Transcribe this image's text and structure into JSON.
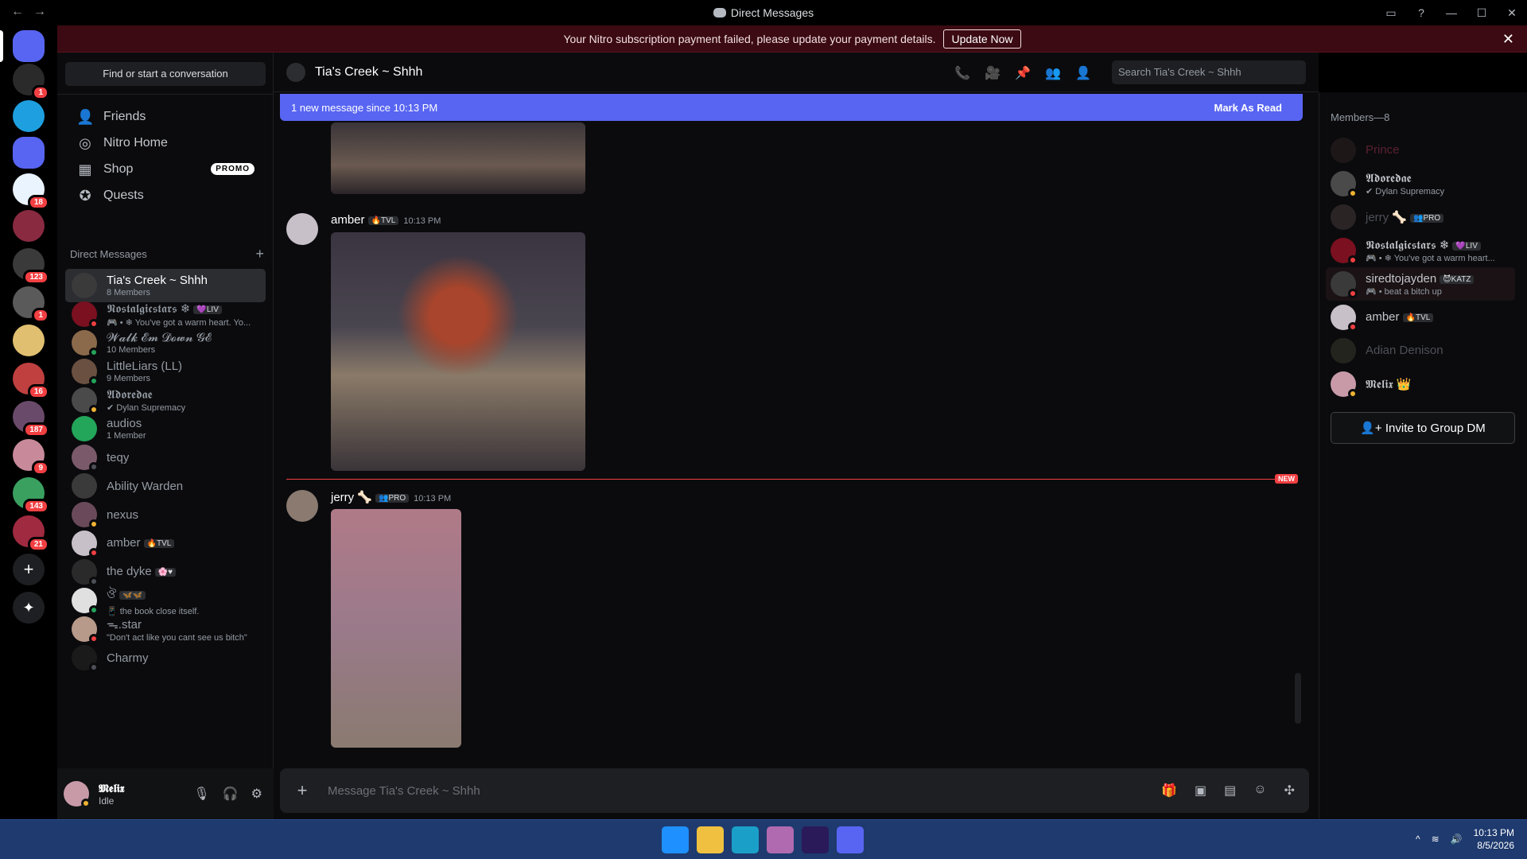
{
  "window": {
    "title": "Direct Messages"
  },
  "banner": {
    "text": "Your Nitro subscription payment failed, please update your payment details.",
    "button": "Update Now"
  },
  "servers": [
    {
      "badge": "1"
    },
    {
      "badge": ""
    },
    {
      "badge": ""
    },
    {
      "badge": "18"
    },
    {
      "badge": ""
    },
    {
      "badge": "123"
    },
    {
      "badge": "1"
    },
    {
      "badge": ""
    },
    {
      "badge": "16"
    },
    {
      "badge": "187"
    },
    {
      "badge": "9"
    },
    {
      "badge": "143"
    },
    {
      "badge": "21"
    }
  ],
  "dm_panel": {
    "search_placeholder": "Find or start a conversation",
    "nav": [
      {
        "label": "Friends"
      },
      {
        "label": "Nitro Home"
      },
      {
        "label": "Shop",
        "badge": "PROMO"
      },
      {
        "label": "Quests"
      }
    ],
    "header": "Direct Messages",
    "rows": [
      {
        "name": "Tia's Creek ~ Shhh",
        "sub": "8 Members",
        "color": "#3a3a3a"
      },
      {
        "name": "𝕹𝖔𝖘𝖙𝖆𝖑𝖌𝖎𝖈𝖘𝖙𝖆𝖗𝖘 ❄",
        "tag": "💜LIV",
        "sub": "🎮 • ❄ You've got a warm heart. Yo...",
        "color": "#7a1020"
      },
      {
        "name": "𝓦𝓪𝓵𝓴 𝓔𝓶 𝓓𝓸𝔀𝓷 𝓖𝓔",
        "sub": "10 Members",
        "color": "#8a6a4a"
      },
      {
        "name": "LittleLiars (LL)",
        "sub": "9 Members",
        "color": "#6a5040"
      },
      {
        "name": "𝕬𝖉𝖔𝖗𝖊𝖉𝖆𝖊",
        "sub": "✔ Dylan Supremacy",
        "color": "#4a4a4a"
      },
      {
        "name": "audios",
        "sub": "1 Member",
        "color": "#23a55a"
      },
      {
        "name": "teqy",
        "sub": "",
        "color": "#7a5a6a"
      },
      {
        "name": "Ability Warden",
        "sub": "",
        "color": "#3a3a3a"
      },
      {
        "name": "nexus",
        "sub": "",
        "color": "#6a4a5a"
      },
      {
        "name": "amber",
        "tag": "🔥TVL",
        "sub": "",
        "color": "#c8c0c8"
      },
      {
        "name": "the dyke",
        "tag": "🌸♥",
        "sub": "",
        "color": "#2a2a2a"
      },
      {
        "name": "ঔ",
        "tag": "🦋🦋",
        "sub": "📱 the book close itself.",
        "color": "#e0e0e0"
      },
      {
        "name": "ᯓ.star",
        "sub": "\"Don't act like you cant see us bitch\"",
        "color": "#b89a8a"
      },
      {
        "name": "Charmy",
        "sub": "",
        "color": "#1a1a1a"
      }
    ]
  },
  "user": {
    "name": "𝕸𝖊𝖑𝖎𝖝",
    "status": "Idle"
  },
  "chat": {
    "channel": "Tia's Creek ~ Shhh",
    "search_placeholder": "Search Tia's Creek ~ Shhh",
    "new_bar": {
      "text": "1 new message since 10:13 PM",
      "action": "Mark As Read"
    },
    "messages": [
      {
        "author": "amber",
        "tag": "🔥TVL",
        "time": "10:13 PM"
      },
      {
        "author": "jerry 🦴",
        "tag": "👥PRO",
        "time": "10:13 PM"
      }
    ],
    "new_label": "NEW",
    "composer_placeholder": "Message Tia's Creek ~ Shhh"
  },
  "members": {
    "header": "Members—8",
    "list": [
      {
        "name": "Prince",
        "sub": "",
        "dim": true,
        "color": "#3a2a2a"
      },
      {
        "name": "𝕬𝖉𝖔𝖗𝖊𝖉𝖆𝖊",
        "sub": "✔ Dylan Supremacy",
        "dim": false,
        "color": "#4a4a4a"
      },
      {
        "name": "jerry 🦴",
        "tag": "👥PRO",
        "sub": "",
        "dim": true,
        "color": "#5a4a4a"
      },
      {
        "name": "𝕹𝖔𝖘𝖙𝖆𝖑𝖌𝖎𝖈𝖘𝖙𝖆𝖗𝖘 ❄",
        "tag": "💜LIV",
        "sub": "🎮 • ❄ You've got a warm heart...",
        "dim": false,
        "color": "#7a1020"
      },
      {
        "name": "siredtojayden",
        "tag": "😈KATZ",
        "sub": "🎮 • beat a bitch up",
        "dim": false,
        "color": "#3a3a3a"
      },
      {
        "name": "amber",
        "tag": "🔥TVL",
        "sub": "",
        "dim": false,
        "color": "#c8c0c8"
      },
      {
        "name": "Adian Denison",
        "sub": "",
        "dim": true,
        "color": "#4a4a3a"
      },
      {
        "name": "𝕸𝖊𝖑𝖎𝖝 👑",
        "sub": "",
        "dim": false,
        "color": "#c89aa8"
      }
    ],
    "invite": "Invite to Group DM"
  },
  "taskbar": {
    "time": "10:13 PM",
    "date": "8/5/2026"
  },
  "colors": {
    "accent": "#5865f2",
    "danger": "#f23f42",
    "online": "#23a55a",
    "idle": "#f0b232",
    "dnd": "#f23f42"
  }
}
